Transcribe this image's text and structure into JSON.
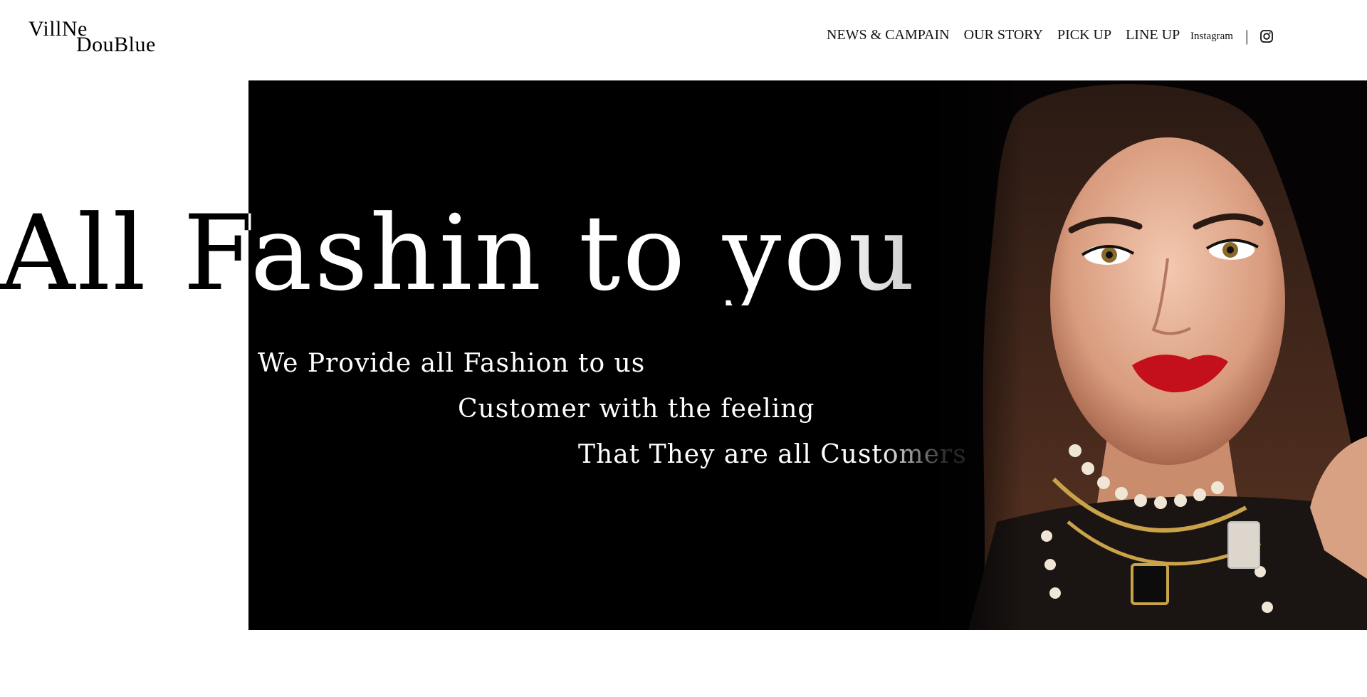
{
  "brand": {
    "logo_line1": "VillNe",
    "logo_line2": "DouBlue"
  },
  "nav": {
    "items": [
      {
        "label": "NEWS & CAMPAIN"
      },
      {
        "label": "OUR STORY"
      },
      {
        "label": "PICK UP"
      },
      {
        "label": "LINE UP"
      }
    ]
  },
  "social": {
    "instagram_label": "Instagram",
    "separator": "|",
    "icon": "instagram-icon"
  },
  "hero": {
    "headline": "All Fashin to you",
    "lines": [
      "We Provide all Fashion to us",
      "Customer with the feeling",
      "That They are all Customers"
    ],
    "photo_icon": "model-portrait"
  },
  "colors": {
    "background": "#ffffff",
    "hero_background": "#000000",
    "text_dark": "#000000",
    "text_light": "#ffffff",
    "lip_accent": "#c4101c"
  }
}
